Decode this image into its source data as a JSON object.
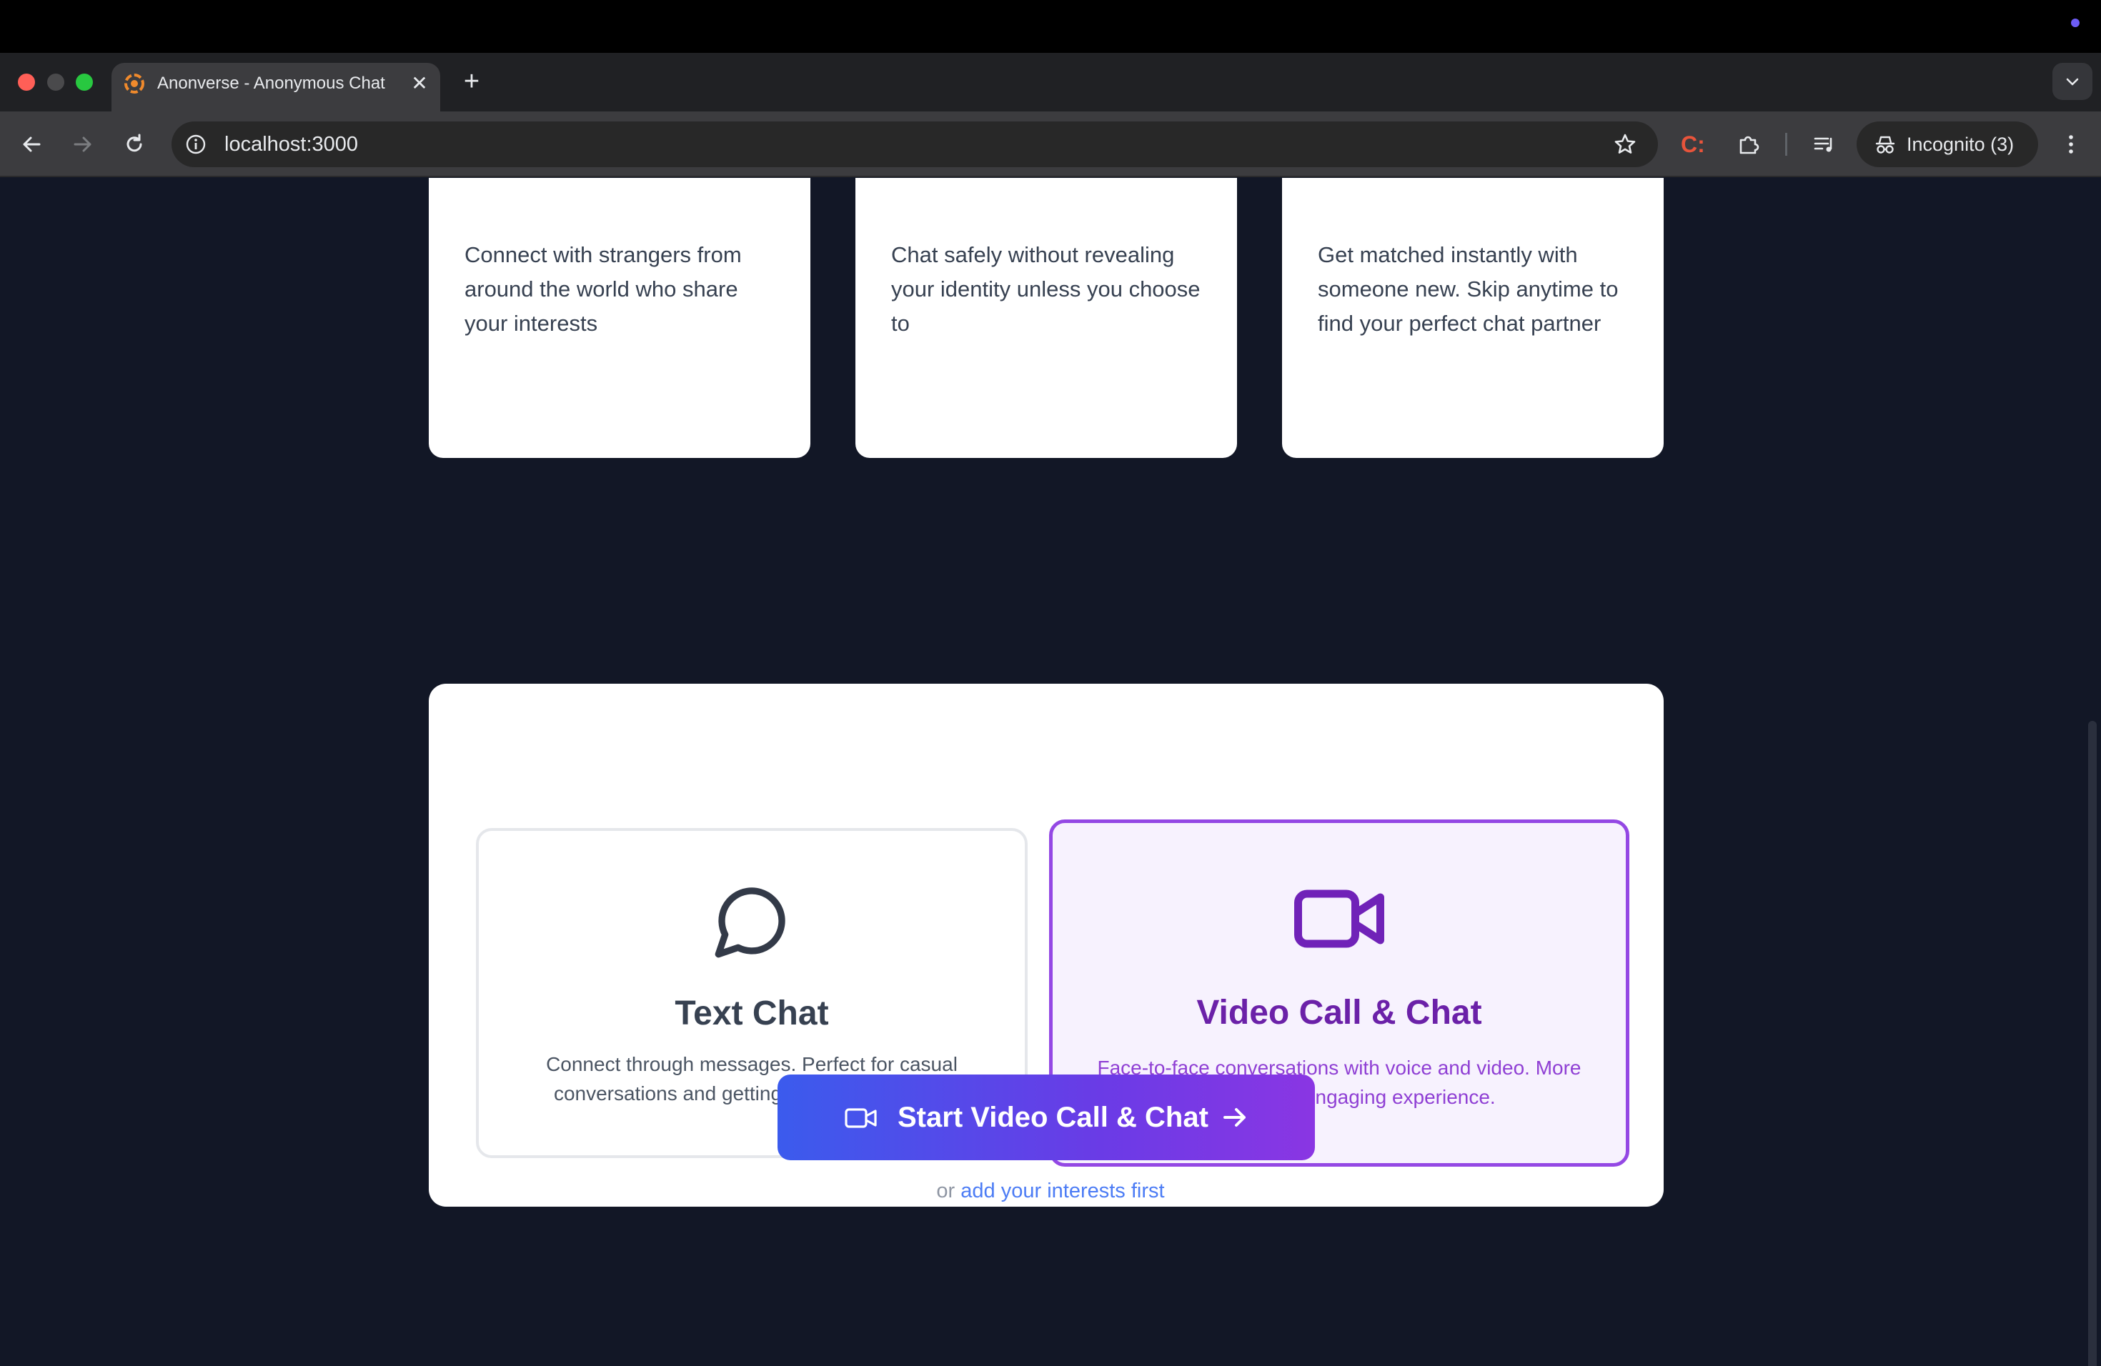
{
  "browser": {
    "tab_title": "Anonverse - Anonymous Chat",
    "url": "localhost:3000",
    "incognito_label": "Incognito (3)",
    "extension_label": "C:"
  },
  "features": [
    {
      "description": "Connect with strangers from around the world who share your interests"
    },
    {
      "description": "Chat safely without revealing your identity unless you choose to"
    },
    {
      "description": "Get matched instantly with someone new. Skip anytime to find your perfect chat partner"
    }
  ],
  "modes": {
    "text": {
      "title": "Text Chat",
      "description": "Connect through messages. Perfect for casual conversations and getting to know someone."
    },
    "video": {
      "title": "Video Call & Chat",
      "description": "Face-to-face conversations with voice and video. More personal and engaging experience.",
      "selected": true
    }
  },
  "start_button": {
    "label": "Start Video Call & Chat"
  },
  "alt": {
    "prefix": "or",
    "link": "add your interests first"
  },
  "colors": {
    "page_bg": "#121726",
    "accent_purple": "#6b21a8",
    "link_blue": "#4c7cf5",
    "button_gradient_start": "#3b5bed",
    "button_gradient_end": "#8a36e3"
  }
}
